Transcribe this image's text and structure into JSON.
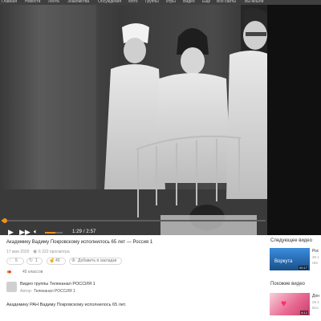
{
  "topbar": {
    "items": [
      "Главная",
      "Новости",
      "Лента",
      "Знакомства",
      "Обсуждения",
      "Фото",
      "Группы",
      "Игры",
      "Видео",
      "Еще",
      "Все сайты",
      "Вы вошли"
    ]
  },
  "player": {
    "time": "1:29 / 2:57",
    "progress": 0.0,
    "volume": 0.6,
    "accent": "#f3901d",
    "icons": [
      "play-icon",
      "skip-forward-icon",
      "volume-icon"
    ]
  },
  "video": {
    "title": "Академику Вадиму Покровскому исполнилось 65 лет — Россия 1",
    "date": "17 мая 2020",
    "views": "6 322 просмотра",
    "comments": "5",
    "reshares": "1",
    "likes_count": "45",
    "add_label": "Добавить в закладки",
    "klass": "45 классов",
    "group_title": "Видео группы Телеканал РОССИЯ 1",
    "author_label": "Автор:",
    "author_name": "Телеканал РОССИЯ 1",
    "description": "Академику РАН Вадиму Покровскому исполнилось 65 лет."
  },
  "sidebar": {
    "next_heading": "Следующее видео",
    "next_item": {
      "title": "Рос",
      "meta1": "28 1",
      "meta2": "Ute",
      "thumb_caption": "Воркута",
      "duration": "00:17"
    },
    "similar_heading": "Похожие видео",
    "similar_item": {
      "title": "Дон",
      "meta1": "28 2",
      "meta2": "Воз",
      "duration": "8:12"
    }
  }
}
